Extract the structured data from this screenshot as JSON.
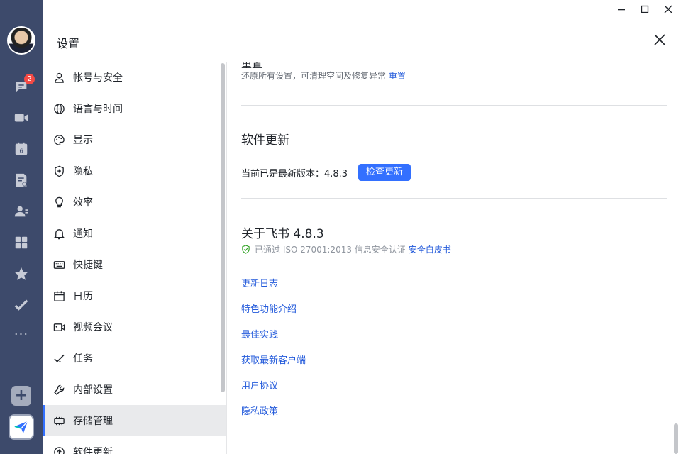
{
  "rail": {
    "chat_badge": "2",
    "calendar_day": "6",
    "more": "···",
    "add": "+",
    "items": [
      {
        "icon": "chat-icon"
      },
      {
        "icon": "video-icon"
      },
      {
        "icon": "calendar-icon"
      },
      {
        "icon": "docs-icon"
      },
      {
        "icon": "contacts-icon"
      },
      {
        "icon": "workplace-icon"
      },
      {
        "icon": "favorites-icon"
      },
      {
        "icon": "tasks-icon"
      }
    ],
    "colors": {
      "background": "#3d4a6b",
      "badge": "#f54a45"
    }
  },
  "settings": {
    "title": "设置",
    "nav": [
      {
        "label": "帐号与安全",
        "icon": "user-icon"
      },
      {
        "label": "语言与时间",
        "icon": "globe-icon"
      },
      {
        "label": "显示",
        "icon": "palette-icon"
      },
      {
        "label": "隐私",
        "icon": "shield-icon"
      },
      {
        "label": "效率",
        "icon": "lightbulb-icon"
      },
      {
        "label": "通知",
        "icon": "bell-icon"
      },
      {
        "label": "快捷键",
        "icon": "keyboard-icon"
      },
      {
        "label": "日历",
        "icon": "calendar-icon"
      },
      {
        "label": "视频会议",
        "icon": "video-icon"
      },
      {
        "label": "任务",
        "icon": "task-check-icon"
      },
      {
        "label": "内部设置",
        "icon": "wrench-icon"
      },
      {
        "label": "存储管理",
        "icon": "chip-icon",
        "active": true
      },
      {
        "label": "软件更新",
        "icon": "upload-circle-icon"
      }
    ],
    "colors": {
      "accent": "#3370ff",
      "link": "#245bdb",
      "active_bg": "#e9eaec"
    }
  },
  "content": {
    "reset": {
      "heading_partial": "重置",
      "description": "还原所有设置，可清理空间及修复异常",
      "link": "重置"
    },
    "update": {
      "title": "软件更新",
      "version_text": "当前已是最新版本：4.8.3",
      "check_button": "检查更新"
    },
    "about": {
      "title": "关于飞书 4.8.3",
      "cert_text": "已通过 ISO 27001:2013 信息安全认证",
      "cert_link": "安全白皮书",
      "links": [
        "更新日志",
        "特色功能介绍",
        "最佳实践",
        "获取最新客户端",
        "用户协议",
        "隐私政策"
      ]
    }
  }
}
